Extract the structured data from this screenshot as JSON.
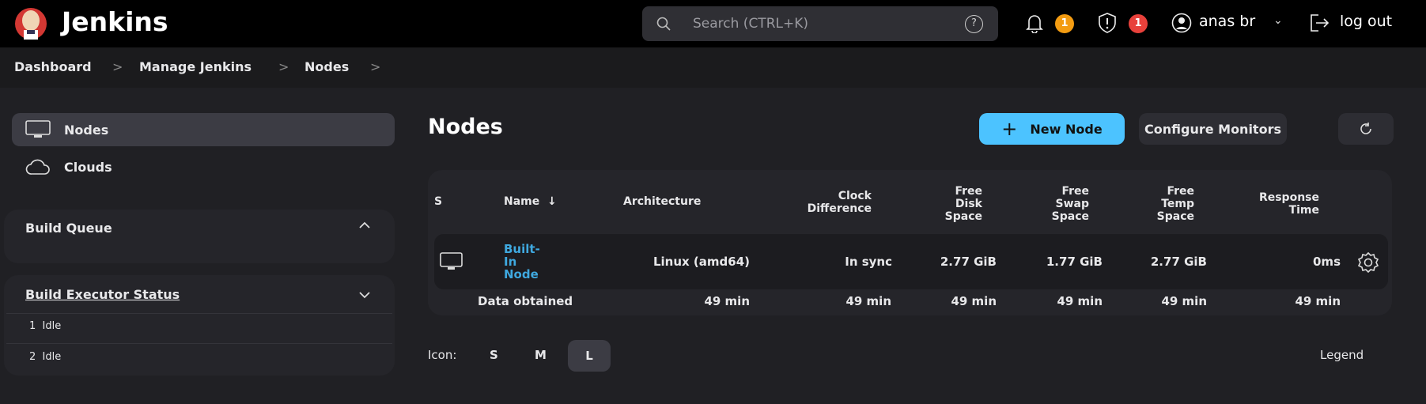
{
  "header": {
    "brand": "Jenkins",
    "search_placeholder": "Search (CTRL+K)",
    "notifications_count": "1",
    "security_count": "1",
    "user": "anas br",
    "logout": "log out"
  },
  "breadcrumb": [
    "Dashboard",
    "Manage Jenkins",
    "Nodes"
  ],
  "sidebar": {
    "items": [
      {
        "label": "Nodes"
      },
      {
        "label": "Clouds"
      }
    ],
    "build_queue": {
      "title": "Build Queue"
    },
    "executors": {
      "title": "Build Executor Status",
      "rows": [
        {
          "num": "1",
          "status": "Idle"
        },
        {
          "num": "2",
          "status": "Idle"
        }
      ]
    }
  },
  "main": {
    "title": "Nodes",
    "new_node": "New Node",
    "configure_monitors": "Configure Monitors",
    "columns": {
      "s": "S",
      "name": "Name",
      "name_sort": "↓",
      "arch": "Architecture",
      "clock": [
        "Clock",
        "Difference"
      ],
      "disk": [
        "Free",
        "Disk",
        "Space"
      ],
      "swap": [
        "Free",
        "Swap",
        "Space"
      ],
      "temp": [
        "Free",
        "Temp",
        "Space"
      ],
      "resp": [
        "Response",
        "Time"
      ]
    },
    "rows": [
      {
        "name": [
          "Built-",
          "In",
          "Node"
        ],
        "arch": "Linux (amd64)",
        "clock": "In sync",
        "disk": "2.77 GiB",
        "swap": "1.77 GiB",
        "temp": "2.77 GiB",
        "resp": "0ms"
      }
    ],
    "data_obtained": {
      "label": "Data obtained",
      "arch": "49 min",
      "clock": "49 min",
      "disk": "49 min",
      "swap": "49 min",
      "temp": "49 min",
      "resp": "49 min"
    },
    "icon_size": {
      "label": "Icon:",
      "options": [
        "S",
        "M",
        "L"
      ],
      "selected": "L"
    },
    "legend": "Legend"
  },
  "colors": {
    "accent": "#4cc3ff",
    "link": "#3fa9e0",
    "warn": "#f39c12",
    "danger": "#e8413b"
  }
}
